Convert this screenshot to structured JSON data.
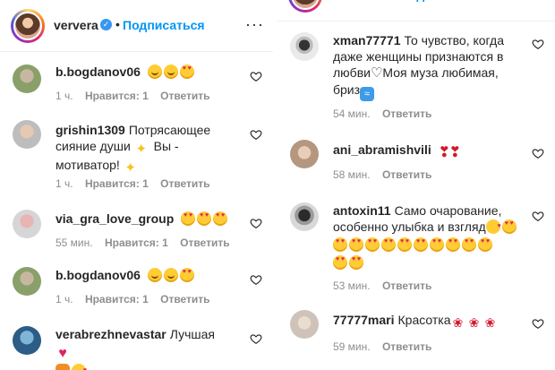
{
  "post": {
    "username": "ververa",
    "dot": "•",
    "follow_label": "Подписаться",
    "more": "···",
    "verified_mark": "✓"
  },
  "left_comments": [
    {
      "username": "b.bogdanov06",
      "text": "",
      "time": "1 ч.",
      "likes": "Нравится: 1",
      "reply": "Ответить"
    },
    {
      "username": "grishin1309",
      "text": "Потрясающее сияние души ",
      "text2": " Вы - мотиватор! ",
      "time": "1 ч.",
      "likes": "Нравится: 1",
      "reply": "Ответить"
    },
    {
      "username": "via_gra_love_group",
      "text": "",
      "time": "55 мин.",
      "likes": "Нравится: 1",
      "reply": "Ответить"
    },
    {
      "username": "b.bogdanov06",
      "text": "",
      "time": "1 ч.",
      "likes": "Нравится: 1",
      "reply": "Ответить"
    },
    {
      "username": "verabrezhnevastar",
      "text": "Лучшая ",
      "time": "",
      "likes": "",
      "reply": ""
    }
  ],
  "right_comments": [
    {
      "username": "xman77771",
      "text": "То чувство, когда даже женщины признаются в любви",
      "text2": "Моя муза любимая, бриз",
      "time": "54 мин.",
      "reply": "Ответить"
    },
    {
      "username": "ani_abramishvili",
      "text": "",
      "time": "58 мин.",
      "reply": "Ответить"
    },
    {
      "username": "antoxin11",
      "text": "Само очарование, особенно улыбка и взгляд",
      "time": "53 мин.",
      "reply": "Ответить"
    },
    {
      "username": "77777mari",
      "text": "Красотка",
      "time": "59 мин.",
      "reply": "Ответить"
    }
  ],
  "icons": {
    "heart": "heart-outline-icon",
    "verified": "verified-badge-icon",
    "more": "more-options-icon"
  },
  "colors": {
    "link_blue": "#0095f6",
    "verified_blue": "#3897f0",
    "meta_gray": "#8e8e8e",
    "text": "#262626"
  }
}
